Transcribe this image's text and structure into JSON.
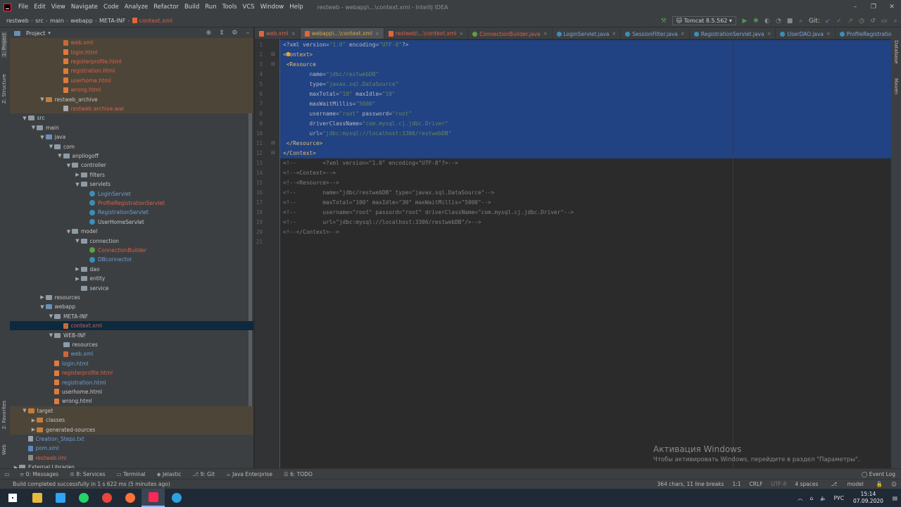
{
  "menu": {
    "items": [
      "File",
      "Edit",
      "View",
      "Navigate",
      "Code",
      "Analyze",
      "Refactor",
      "Build",
      "Run",
      "Tools",
      "VCS",
      "Window",
      "Help"
    ],
    "window_title": "restweb - webapp\\...\\context.xml - IntelliJ IDEA"
  },
  "breadcrumb": [
    "restweb",
    "src",
    "main",
    "webapp",
    "META-INF",
    "context.xml"
  ],
  "run_config": {
    "label": "Tomcat 8.5.562",
    "git_label": "Git:"
  },
  "side_tabs": {
    "project": "1: Project",
    "structure": "Z: Structure",
    "favorites": "2: Favorites",
    "web": "Web",
    "database": "Database",
    "maven": "Maven"
  },
  "project_panel": {
    "title": "Project"
  },
  "tree": [
    {
      "label": "web.xml",
      "indent": 5,
      "type": "xml",
      "color": "red",
      "hl": true,
      "arrow": ""
    },
    {
      "label": "login.html",
      "indent": 5,
      "type": "html",
      "color": "red",
      "hl": true,
      "arrow": ""
    },
    {
      "label": "registerprofile.html",
      "indent": 5,
      "type": "html",
      "color": "red",
      "hl": true,
      "arrow": ""
    },
    {
      "label": "registration.html",
      "indent": 5,
      "type": "html",
      "color": "red",
      "hl": true,
      "arrow": ""
    },
    {
      "label": "userhome.html",
      "indent": 5,
      "type": "html",
      "color": "red",
      "hl": true,
      "arrow": ""
    },
    {
      "label": "wrong.html",
      "indent": 5,
      "type": "html",
      "color": "red",
      "hl": true,
      "arrow": ""
    },
    {
      "label": "restweb_archive",
      "indent": 3,
      "type": "folder-orange",
      "color": "norm",
      "hl": true,
      "arrow": "▼"
    },
    {
      "label": "restweb archive.war",
      "indent": 5,
      "type": "war",
      "color": "red",
      "hl": true,
      "arrow": ""
    },
    {
      "label": "src",
      "indent": 1,
      "type": "folder",
      "color": "norm",
      "hl": false,
      "arrow": "▼"
    },
    {
      "label": "main",
      "indent": 2,
      "type": "folder",
      "color": "norm",
      "hl": false,
      "arrow": "▼"
    },
    {
      "label": "java",
      "indent": 3,
      "type": "folder-blue",
      "color": "norm",
      "hl": false,
      "arrow": "▼"
    },
    {
      "label": "com",
      "indent": 4,
      "type": "folder",
      "color": "norm",
      "hl": false,
      "arrow": "▼"
    },
    {
      "label": "anpilogoff",
      "indent": 5,
      "type": "folder",
      "color": "norm",
      "hl": false,
      "arrow": "▼"
    },
    {
      "label": "controller",
      "indent": 6,
      "type": "folder",
      "color": "norm",
      "hl": false,
      "arrow": "▼"
    },
    {
      "label": "filters",
      "indent": 7,
      "type": "folder",
      "color": "norm",
      "hl": false,
      "arrow": "▶"
    },
    {
      "label": "servlets",
      "indent": 7,
      "type": "folder",
      "color": "norm",
      "hl": false,
      "arrow": "▼"
    },
    {
      "label": "LoginServlet",
      "indent": 8,
      "type": "class",
      "color": "blue",
      "hl": false,
      "arrow": ""
    },
    {
      "label": "ProfileRegistrationServlet",
      "indent": 8,
      "type": "class",
      "color": "red",
      "hl": false,
      "arrow": ""
    },
    {
      "label": "RegistrationServlet",
      "indent": 8,
      "type": "class",
      "color": "blue",
      "hl": false,
      "arrow": ""
    },
    {
      "label": "UserHomeServlet",
      "indent": 8,
      "type": "class",
      "color": "norm",
      "hl": false,
      "arrow": ""
    },
    {
      "label": "model",
      "indent": 6,
      "type": "folder",
      "color": "norm",
      "hl": false,
      "arrow": "▼"
    },
    {
      "label": "connection",
      "indent": 7,
      "type": "folder",
      "color": "norm",
      "hl": false,
      "arrow": "▼"
    },
    {
      "label": "ConnectionBuilder",
      "indent": 8,
      "type": "class-g",
      "color": "red",
      "hl": false,
      "arrow": ""
    },
    {
      "label": "DBconnector",
      "indent": 8,
      "type": "class",
      "color": "blue",
      "hl": false,
      "arrow": ""
    },
    {
      "label": "dao",
      "indent": 7,
      "type": "folder",
      "color": "norm",
      "hl": false,
      "arrow": "▶"
    },
    {
      "label": "entity",
      "indent": 7,
      "type": "folder",
      "color": "norm",
      "hl": false,
      "arrow": "▶"
    },
    {
      "label": "service",
      "indent": 7,
      "type": "folder",
      "color": "norm",
      "hl": false,
      "arrow": ""
    },
    {
      "label": "resources",
      "indent": 3,
      "type": "folder",
      "color": "norm",
      "hl": false,
      "arrow": "▶"
    },
    {
      "label": "webapp",
      "indent": 3,
      "type": "folder-blue",
      "color": "norm",
      "hl": false,
      "arrow": "▼"
    },
    {
      "label": "META-INF",
      "indent": 4,
      "type": "folder",
      "color": "norm",
      "hl": false,
      "arrow": "▼"
    },
    {
      "label": "context.xml",
      "indent": 5,
      "type": "xml",
      "color": "red",
      "hl": false,
      "sel": true,
      "arrow": ""
    },
    {
      "label": "WEB-INF",
      "indent": 4,
      "type": "folder",
      "color": "norm",
      "hl": false,
      "arrow": "▼"
    },
    {
      "label": "resources",
      "indent": 5,
      "type": "folder",
      "color": "norm",
      "hl": false,
      "arrow": ""
    },
    {
      "label": "web.xml",
      "indent": 5,
      "type": "xml",
      "color": "blue",
      "hl": false,
      "arrow": ""
    },
    {
      "label": "login.html",
      "indent": 4,
      "type": "html",
      "color": "blue",
      "hl": false,
      "arrow": ""
    },
    {
      "label": "registerprofile.html",
      "indent": 4,
      "type": "html",
      "color": "red",
      "hl": false,
      "arrow": ""
    },
    {
      "label": "registration.html",
      "indent": 4,
      "type": "html",
      "color": "blue",
      "hl": false,
      "arrow": ""
    },
    {
      "label": "userhome.html",
      "indent": 4,
      "type": "html",
      "color": "norm",
      "hl": false,
      "arrow": ""
    },
    {
      "label": "wrong.html",
      "indent": 4,
      "type": "html",
      "color": "norm",
      "hl": false,
      "arrow": ""
    },
    {
      "label": "target",
      "indent": 1,
      "type": "folder-orange",
      "color": "norm",
      "hl": true,
      "arrow": "▼"
    },
    {
      "label": "classes",
      "indent": 2,
      "type": "folder-orange",
      "color": "norm",
      "hl": true,
      "arrow": "▶"
    },
    {
      "label": "generated-sources",
      "indent": 2,
      "type": "folder-orange",
      "color": "norm",
      "hl": true,
      "arrow": "▶"
    },
    {
      "label": "Creation_Steps.txt",
      "indent": 1,
      "type": "txt",
      "color": "blue",
      "hl": false,
      "arrow": ""
    },
    {
      "label": "pom.xml",
      "indent": 1,
      "type": "pom",
      "color": "blue",
      "hl": false,
      "arrow": ""
    },
    {
      "label": "restweb.iml",
      "indent": 1,
      "type": "iml",
      "color": "red",
      "hl": false,
      "arrow": ""
    },
    {
      "label": "External Libraries",
      "indent": 0,
      "type": "folder",
      "color": "norm",
      "hl": false,
      "arrow": "▶"
    }
  ],
  "tabs": [
    {
      "label": "web.xml",
      "kind": "xml",
      "active": false
    },
    {
      "label": "webapp\\...\\context.xml",
      "kind": "xml",
      "active": true
    },
    {
      "label": "restweb\\...\\context.xml",
      "kind": "xml",
      "active": false
    },
    {
      "label": "ConnectionBuilder.java",
      "kind": "java-g",
      "active": false
    },
    {
      "label": "LoginServlet.java",
      "kind": "java",
      "active": false
    },
    {
      "label": "SessionFilter.java",
      "kind": "java",
      "active": false
    },
    {
      "label": "RegistrationServlet.java",
      "kind": "java",
      "active": false
    },
    {
      "label": "UserDAO.java",
      "kind": "java",
      "active": false
    },
    {
      "label": "ProfileRegistrationServlet.java",
      "kind": "java",
      "active": false
    }
  ],
  "code_lines": [
    {
      "n": "1",
      "sel": true,
      "parts": [
        [
          "pi",
          "<?xml version="
        ],
        [
          "val",
          "\"1.0\""
        ],
        [
          "pi",
          " encoding="
        ],
        [
          "val",
          "\"UTF-8\""
        ],
        [
          "pi",
          "?>"
        ]
      ]
    },
    {
      "n": "2",
      "sel": true,
      "parts": [
        [
          "tag",
          "<Context>"
        ]
      ]
    },
    {
      "n": "3",
      "sel": true,
      "parts": [
        [
          "tag",
          " <Resource"
        ]
      ]
    },
    {
      "n": "4",
      "sel": true,
      "parts": [
        [
          "attr",
          "        name="
        ],
        [
          "val",
          "\"jdbc/restwebDB\""
        ]
      ]
    },
    {
      "n": "5",
      "sel": true,
      "parts": [
        [
          "attr",
          "        type="
        ],
        [
          "val",
          "\"javax.sql.DataSource\""
        ]
      ]
    },
    {
      "n": "6",
      "sel": true,
      "parts": [
        [
          "attr",
          "        maxTotal="
        ],
        [
          "val",
          "\"10\""
        ],
        [
          "attr",
          " maxIdle="
        ],
        [
          "val",
          "\"10\""
        ]
      ]
    },
    {
      "n": "7",
      "sel": true,
      "parts": [
        [
          "attr",
          "        maxWaitMillis="
        ],
        [
          "val",
          "\"5000\""
        ]
      ]
    },
    {
      "n": "8",
      "sel": true,
      "parts": [
        [
          "attr",
          "        username="
        ],
        [
          "val",
          "\"root\""
        ],
        [
          "attr",
          " password="
        ],
        [
          "val",
          "\"root\""
        ]
      ]
    },
    {
      "n": "9",
      "sel": true,
      "parts": [
        [
          "attr",
          "        driverClassName="
        ],
        [
          "val",
          "\"com.mysql.cj.jdbc.Driver\""
        ]
      ]
    },
    {
      "n": "10",
      "sel": true,
      "parts": [
        [
          "attr",
          "        url="
        ],
        [
          "val",
          "\"jdbc:mysql://localhost:3306/restwebDB\""
        ]
      ]
    },
    {
      "n": "11",
      "sel": true,
      "parts": [
        [
          "tag",
          " </Resource>"
        ]
      ]
    },
    {
      "n": "12",
      "sel": true,
      "parts": [
        [
          "tag",
          "</Context>"
        ]
      ]
    },
    {
      "n": "13",
      "sel": false,
      "parts": [
        [
          "com",
          "<!--        <?xml version=\"1.0\" encoding=\"UTF-8\"?>-->"
        ]
      ]
    },
    {
      "n": "14",
      "sel": false,
      "parts": [
        [
          "com",
          "<!--<Context>-->"
        ]
      ]
    },
    {
      "n": "15",
      "sel": false,
      "parts": [
        [
          "com",
          "<!--<Resource>-->"
        ]
      ]
    },
    {
      "n": "16",
      "sel": false,
      "parts": [
        [
          "com",
          "<!--        name=\"jdbc/restwebDB\" type=\"javax.sql.DataSource\"-->"
        ]
      ]
    },
    {
      "n": "17",
      "sel": false,
      "parts": [
        [
          "com",
          "<!--        maxTotal=\"100\" maxIdle=\"30\" maxWaitMillis=\"5000\"-->"
        ]
      ]
    },
    {
      "n": "18",
      "sel": false,
      "parts": [
        [
          "com",
          "<!--        username=\"root\" passord=\"root\" driverClassName=\"com.mysql.cj.jdbc.Driver\"-->"
        ]
      ]
    },
    {
      "n": "19",
      "sel": false,
      "parts": [
        [
          "com",
          "<!--        url=\"jdbc:mysql://localhost:3306/restwebDB\"/>-->"
        ]
      ]
    },
    {
      "n": "20",
      "sel": false,
      "parts": [
        [
          "com",
          "<!--</Context>-->"
        ]
      ]
    },
    {
      "n": "21",
      "sel": false,
      "parts": []
    }
  ],
  "watermark": {
    "line1": "Активация Windows",
    "line2": "Чтобы активировать Windows, перейдите в раздел \"Параметры\"."
  },
  "bottom_tools": [
    "0: Messages",
    "8: Services",
    "Terminal",
    "Jelastic",
    "9: Git",
    "Java Enterprise",
    "6: TODO"
  ],
  "event_log": "Event Log",
  "status": {
    "message": "Build completed successfully in 1 s 622 ms (5 minutes ago)",
    "chars": "364 chars, 11 line breaks",
    "position": "1:1",
    "line_sep": "CRLF",
    "encoding": "UTF-8",
    "indent": "4 spaces",
    "branch": "model"
  },
  "taskbar": {
    "apps": [
      {
        "name": "windows-start-icon",
        "color": "#ffffff"
      },
      {
        "name": "file-explorer-icon",
        "color": "#e8b83a"
      },
      {
        "name": "photoshop-icon",
        "color": "#2fa3f7"
      },
      {
        "name": "whatsapp-icon",
        "color": "#25d366"
      },
      {
        "name": "chrome-icon",
        "color": "#e8453c"
      },
      {
        "name": "firefox-icon",
        "color": "#ff7139"
      },
      {
        "name": "intellij-icon",
        "color": "#fe2857"
      },
      {
        "name": "telegram-icon",
        "color": "#2aa3df"
      }
    ],
    "lang": "РУС",
    "time": "15:14",
    "date": "07.09.2020"
  }
}
